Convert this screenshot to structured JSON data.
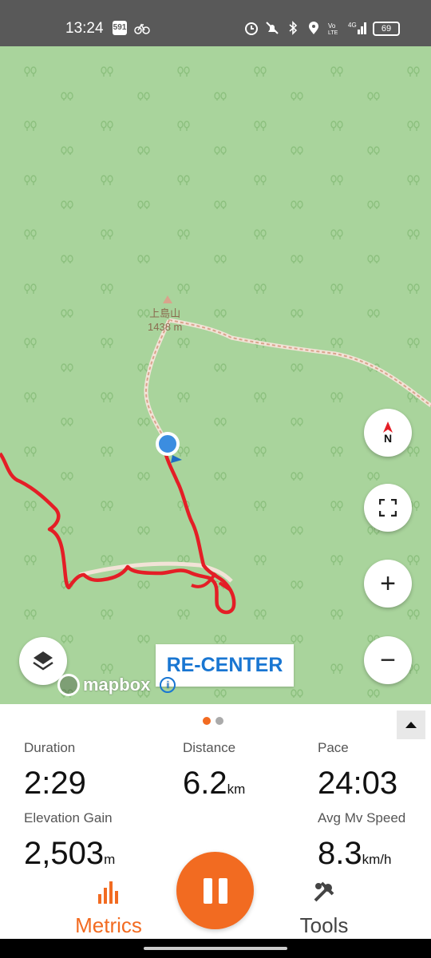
{
  "status_bar": {
    "time": "13:24",
    "badge": "591",
    "battery": "69",
    "icons": [
      "bike-icon",
      "alarm-icon",
      "mute-icon",
      "bluetooth-icon",
      "location-icon",
      "volte-icon",
      "signal-4g-icon",
      "battery-icon"
    ]
  },
  "map": {
    "peak_name": "上島山",
    "peak_elevation": "1438 m",
    "recenter_label": "RE-CENTER",
    "compass_label": "N",
    "zoom_in_label": "+",
    "zoom_out_label": "−",
    "attribution": "mapbox",
    "colors": {
      "land": "#a9d49c",
      "route": "#e41e26",
      "trail": "#e8bfa6",
      "location": "#3b8de0"
    }
  },
  "metrics_panel": {
    "page_dots": [
      {
        "active": true,
        "color": "#f26b21"
      },
      {
        "active": false,
        "color": "#aaaaaa"
      }
    ],
    "duration": {
      "label": "Duration",
      "value": "2:29"
    },
    "distance": {
      "label": "Distance",
      "value": "6.2",
      "unit": "km"
    },
    "pace": {
      "label": "Pace",
      "value": "24:03"
    },
    "elevation_gain": {
      "label": "Elevation Gain",
      "value": "2,503",
      "unit": "m"
    },
    "avg_speed": {
      "label": "Avg Mv Speed",
      "value": "8.3",
      "unit": "km/h"
    }
  },
  "bottom_tabs": {
    "metrics_label": "Metrics",
    "tools_label": "Tools",
    "accent": "#f26b21"
  }
}
